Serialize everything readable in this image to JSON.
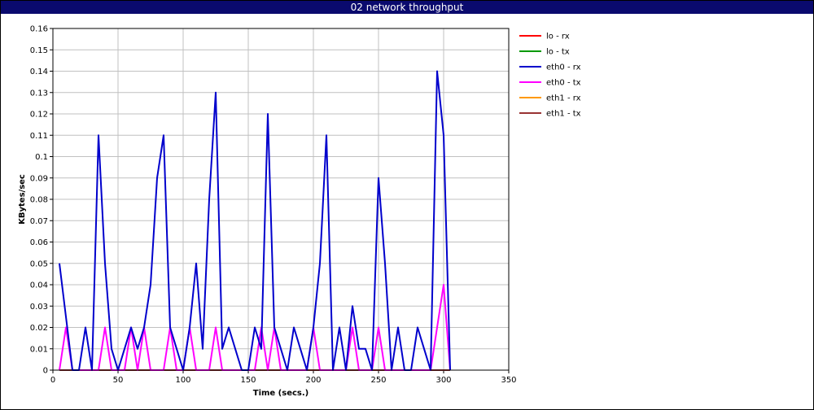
{
  "window": {
    "title": "02 network throughput"
  },
  "chart_data": {
    "type": "line",
    "title": "02 network throughput",
    "xlabel": "Time (secs.)",
    "ylabel": "KBytes/sec",
    "xlim": [
      0,
      350
    ],
    "ylim": [
      0,
      0.16
    ],
    "xticks": [
      0,
      50,
      100,
      150,
      200,
      250,
      300,
      350
    ],
    "yticks": [
      0,
      0.01,
      0.02,
      0.03,
      0.04,
      0.05,
      0.06,
      0.07,
      0.08,
      0.09,
      0.1,
      0.11,
      0.12,
      0.13,
      0.14,
      0.15,
      0.16
    ],
    "grid": true,
    "legend_position": "right",
    "series": [
      {
        "name": "lo - rx",
        "color": "#ff0000",
        "x": [
          5,
          305
        ],
        "y": [
          0,
          0
        ]
      },
      {
        "name": "lo - tx",
        "color": "#009900",
        "x": [
          5,
          305
        ],
        "y": [
          0,
          0
        ]
      },
      {
        "name": "eth0 - rx",
        "color": "#0000cc",
        "x": [
          5,
          15,
          20,
          25,
          30,
          35,
          40,
          45,
          50,
          55,
          60,
          65,
          70,
          75,
          80,
          85,
          90,
          95,
          100,
          105,
          110,
          115,
          120,
          125,
          130,
          135,
          140,
          145,
          150,
          155,
          160,
          165,
          170,
          175,
          180,
          185,
          190,
          195,
          200,
          205,
          210,
          215,
          220,
          225,
          230,
          235,
          240,
          245,
          250,
          255,
          260,
          265,
          270,
          275,
          280,
          285,
          290,
          295,
          300,
          305
        ],
        "y": [
          0.05,
          0,
          0,
          0.02,
          0,
          0.11,
          0.05,
          0.01,
          0,
          0.01,
          0.02,
          0.01,
          0.02,
          0.04,
          0.09,
          0.11,
          0.02,
          0.01,
          0,
          0.02,
          0.05,
          0.01,
          0.08,
          0.13,
          0.01,
          0.02,
          0.01,
          0,
          0,
          0.02,
          0.01,
          0.12,
          0.02,
          0.01,
          0,
          0.02,
          0.01,
          0,
          0.02,
          0.05,
          0.11,
          0,
          0.02,
          0,
          0.03,
          0.01,
          0.01,
          0,
          0.09,
          0.05,
          0,
          0.02,
          0,
          0,
          0.02,
          0.01,
          0,
          0.14,
          0.11,
          0
        ]
      },
      {
        "name": "eth0 - tx",
        "color": "#ff00ff",
        "x": [
          5,
          10,
          15,
          20,
          25,
          30,
          35,
          40,
          45,
          50,
          55,
          60,
          65,
          70,
          75,
          80,
          85,
          90,
          95,
          100,
          105,
          110,
          115,
          120,
          125,
          130,
          135,
          140,
          145,
          150,
          155,
          160,
          165,
          170,
          175,
          180,
          185,
          190,
          195,
          200,
          205,
          210,
          215,
          220,
          225,
          230,
          235,
          240,
          245,
          250,
          255,
          260,
          265,
          270,
          275,
          280,
          285,
          290,
          295,
          300,
          305
        ],
        "y": [
          0,
          0.02,
          0,
          0,
          0,
          0,
          0,
          0.02,
          0,
          0,
          0,
          0.02,
          0,
          0.02,
          0,
          0,
          0,
          0.02,
          0,
          0,
          0.02,
          0,
          0,
          0,
          0.02,
          0,
          0,
          0,
          0,
          0,
          0,
          0.02,
          0,
          0.02,
          0,
          0,
          0,
          0,
          0,
          0.02,
          0,
          0,
          0,
          0,
          0,
          0.02,
          0,
          0,
          0,
          0.02,
          0,
          0,
          0,
          0,
          0,
          0,
          0,
          0,
          0.02,
          0.04,
          0
        ]
      },
      {
        "name": "eth1 - rx",
        "color": "#ff9900",
        "x": [
          5,
          305
        ],
        "y": [
          0,
          0
        ]
      },
      {
        "name": "eth1 - tx",
        "color": "#993333",
        "x": [
          5,
          305
        ],
        "y": [
          0,
          0
        ]
      }
    ]
  }
}
